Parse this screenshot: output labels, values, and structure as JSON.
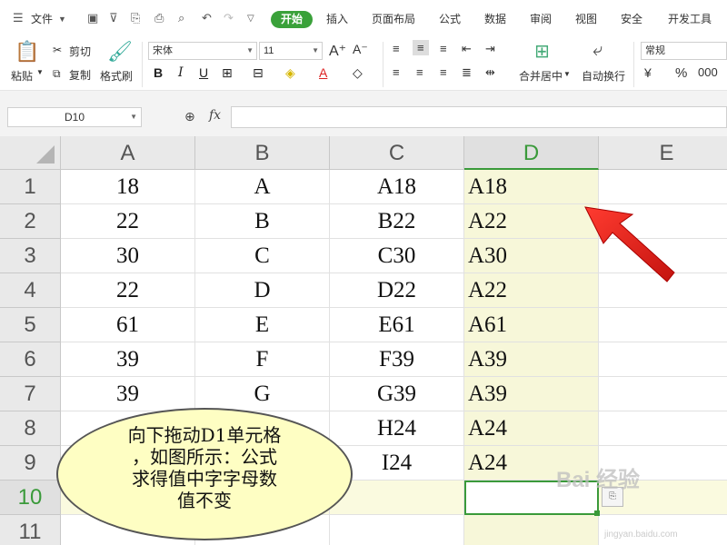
{
  "menubar": {
    "file_label": "文件",
    "tabs": [
      {
        "label": "开始",
        "active": true
      },
      {
        "label": "插入"
      },
      {
        "label": "页面布局"
      },
      {
        "label": "公式"
      },
      {
        "label": "数据"
      },
      {
        "label": "审阅"
      },
      {
        "label": "视图"
      },
      {
        "label": "安全"
      },
      {
        "label": "开发工具"
      }
    ]
  },
  "ribbon": {
    "paste_label": "粘贴",
    "cut_label": "剪切",
    "copy_label": "复制",
    "format_painter_label": "格式刷",
    "font_name": "宋体",
    "font_size": "11",
    "merge_center_label": "合并居中",
    "wrap_text_label": "自动换行",
    "number_format": "常规"
  },
  "formula_bar": {
    "name_box": "D10",
    "fx_label": "fx",
    "formula": ""
  },
  "sheet": {
    "columns": [
      "A",
      "B",
      "C",
      "D",
      "E"
    ],
    "active_column": "D",
    "active_row": "10",
    "rows": [
      {
        "num": "1",
        "A": "18",
        "B": "A",
        "C": "A18",
        "D": "A18"
      },
      {
        "num": "2",
        "A": "22",
        "B": "B",
        "C": "B22",
        "D": "A22"
      },
      {
        "num": "3",
        "A": "30",
        "B": "C",
        "C": "C30",
        "D": "A30"
      },
      {
        "num": "4",
        "A": "22",
        "B": "D",
        "C": "D22",
        "D": "A22"
      },
      {
        "num": "5",
        "A": "61",
        "B": "E",
        "C": "E61",
        "D": "A61"
      },
      {
        "num": "6",
        "A": "39",
        "B": "F",
        "C": "F39",
        "D": "A39"
      },
      {
        "num": "7",
        "A": "39",
        "B": "G",
        "C": "G39",
        "D": "A39"
      },
      {
        "num": "8",
        "A": "",
        "B": "",
        "C": "H24",
        "D": "A24"
      },
      {
        "num": "9",
        "A": "",
        "B": "",
        "C": "I24",
        "D": "A24"
      },
      {
        "num": "10",
        "A": "",
        "B": "",
        "C": "",
        "D": ""
      },
      {
        "num": "11",
        "A": "",
        "B": "",
        "C": "",
        "D": ""
      }
    ]
  },
  "callout": {
    "lines": [
      "向下拖动D1单元格",
      "，如图所示：公式",
      "求得值中字字母数",
      "值不变"
    ]
  },
  "watermark": {
    "text": "Bai 经验",
    "sub": "jingyan.baidu.com"
  },
  "colors": {
    "accent_green": "#3aa13a",
    "arrow_red": "#e8201a",
    "callout_fill": "#fefec3"
  }
}
